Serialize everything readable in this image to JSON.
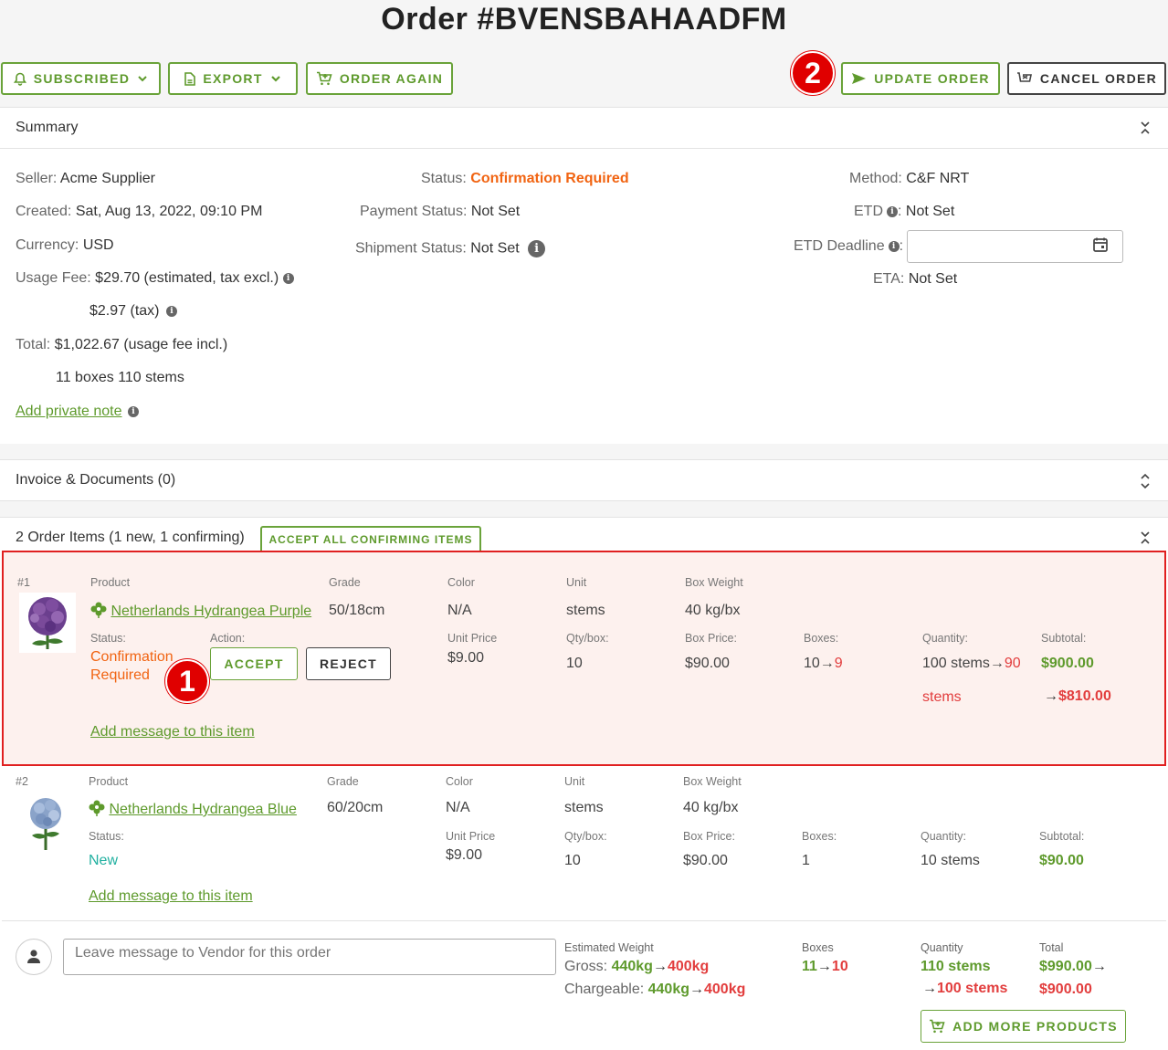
{
  "page": {
    "title": "Order #BVENSBAHAADFM"
  },
  "toolbar": {
    "subscribed": "SUBSCRIBED",
    "export": "EXPORT",
    "order_again": "ORDER AGAIN",
    "update_order": "UPDATE ORDER",
    "cancel_order": "CANCEL ORDER"
  },
  "annotations": {
    "badge1": "1",
    "badge2": "2"
  },
  "summary": {
    "title": "Summary",
    "seller_label": "Seller:",
    "seller": "Acme Supplier",
    "created_label": "Created:",
    "created": "Sat, Aug 13, 2022, 09:10 PM",
    "currency_label": "Currency:",
    "currency": "USD",
    "usage_fee_label": "Usage Fee:",
    "usage_fee": "$29.70 (estimated, tax excl.)",
    "usage_tax": "$2.97 (tax)",
    "total_label": "Total:",
    "total": "$1,022.67 (usage fee incl.)",
    "boxes_stems": "11 boxes 110 stems",
    "private_note": "Add private note",
    "status_label": "Status:",
    "status": "Confirmation Required",
    "payment_label": "Payment Status:",
    "payment": "Not Set",
    "shipment_label": "Shipment Status:",
    "shipment": "Not Set",
    "method_label": "Method:",
    "method": "C&F NRT",
    "etd_label": "ETD",
    "etd": "Not Set",
    "etd_deadline_label": "ETD Deadline",
    "eta_label": "ETA:",
    "eta": "Not Set"
  },
  "invoice": {
    "title": "Invoice & Documents (0)"
  },
  "items_section": {
    "title": "2 Order Items (1 new, 1 confirming)",
    "accept_all": "ACCEPT ALL CONFIRMING ITEMS"
  },
  "headers": {
    "product": "Product",
    "grade": "Grade",
    "color": "Color",
    "unit": "Unit",
    "box_weight": "Box Weight",
    "status": "Status:",
    "action": "Action:",
    "unit_price": "Unit Price",
    "qty_box": "Qty/box:",
    "box_price": "Box Price:",
    "boxes": "Boxes:",
    "quantity": "Quantity:",
    "subtotal": "Subtotal:",
    "add_message": "Add message to this item"
  },
  "items": [
    {
      "index": "#1",
      "name": "Netherlands Hydrangea Purple",
      "grade": "50/18cm",
      "color": "N/A",
      "unit": "stems",
      "box_weight": "40 kg/bx",
      "status_line1": "Confirmation",
      "status_line2": "Required",
      "accept": "ACCEPT",
      "reject": "REJECT",
      "unit_price": "$9.00",
      "qty_box": "10",
      "box_price": "$90.00",
      "boxes_old": "10",
      "boxes_new": "9",
      "qty_old": "100 stems",
      "qty_new": "90",
      "qty_new_unit": "stems",
      "subtotal_old": "$900.00",
      "subtotal_new": "$810.00",
      "arrow": "→"
    },
    {
      "index": "#2",
      "name": "Netherlands Hydrangea Blue",
      "grade": "60/20cm",
      "color": "N/A",
      "unit": "stems",
      "box_weight": "40 kg/bx",
      "status": "New",
      "unit_price": "$9.00",
      "qty_box": "10",
      "box_price": "$90.00",
      "boxes": "1",
      "quantity": "10 stems",
      "subtotal": "$90.00"
    }
  ],
  "footer": {
    "message_placeholder": "Leave message to Vendor for this order",
    "est_weight_label": "Estimated Weight",
    "gross_label": "Gross:",
    "gross_old": "440kg",
    "gross_new": "400kg",
    "chargeable_label": "Chargeable:",
    "chargeable_old": "440kg",
    "chargeable_new": "400kg",
    "boxes_label": "Boxes",
    "boxes_old": "11",
    "boxes_new": "10",
    "quantity_label": "Quantity",
    "quantity_old": "110 stems",
    "quantity_new": "100 stems",
    "total_label": "Total",
    "total_old": "$990.00",
    "total_new": "$900.00",
    "arrow": "→",
    "add_more": "ADD MORE PRODUCTS"
  },
  "colors": {
    "accent": "#5e9a2c",
    "warning": "#f16412",
    "red": "#e23d3d",
    "highlight_bg": "#fdf1ee",
    "highlight_border": "#e02020",
    "badge": "#e00000"
  }
}
